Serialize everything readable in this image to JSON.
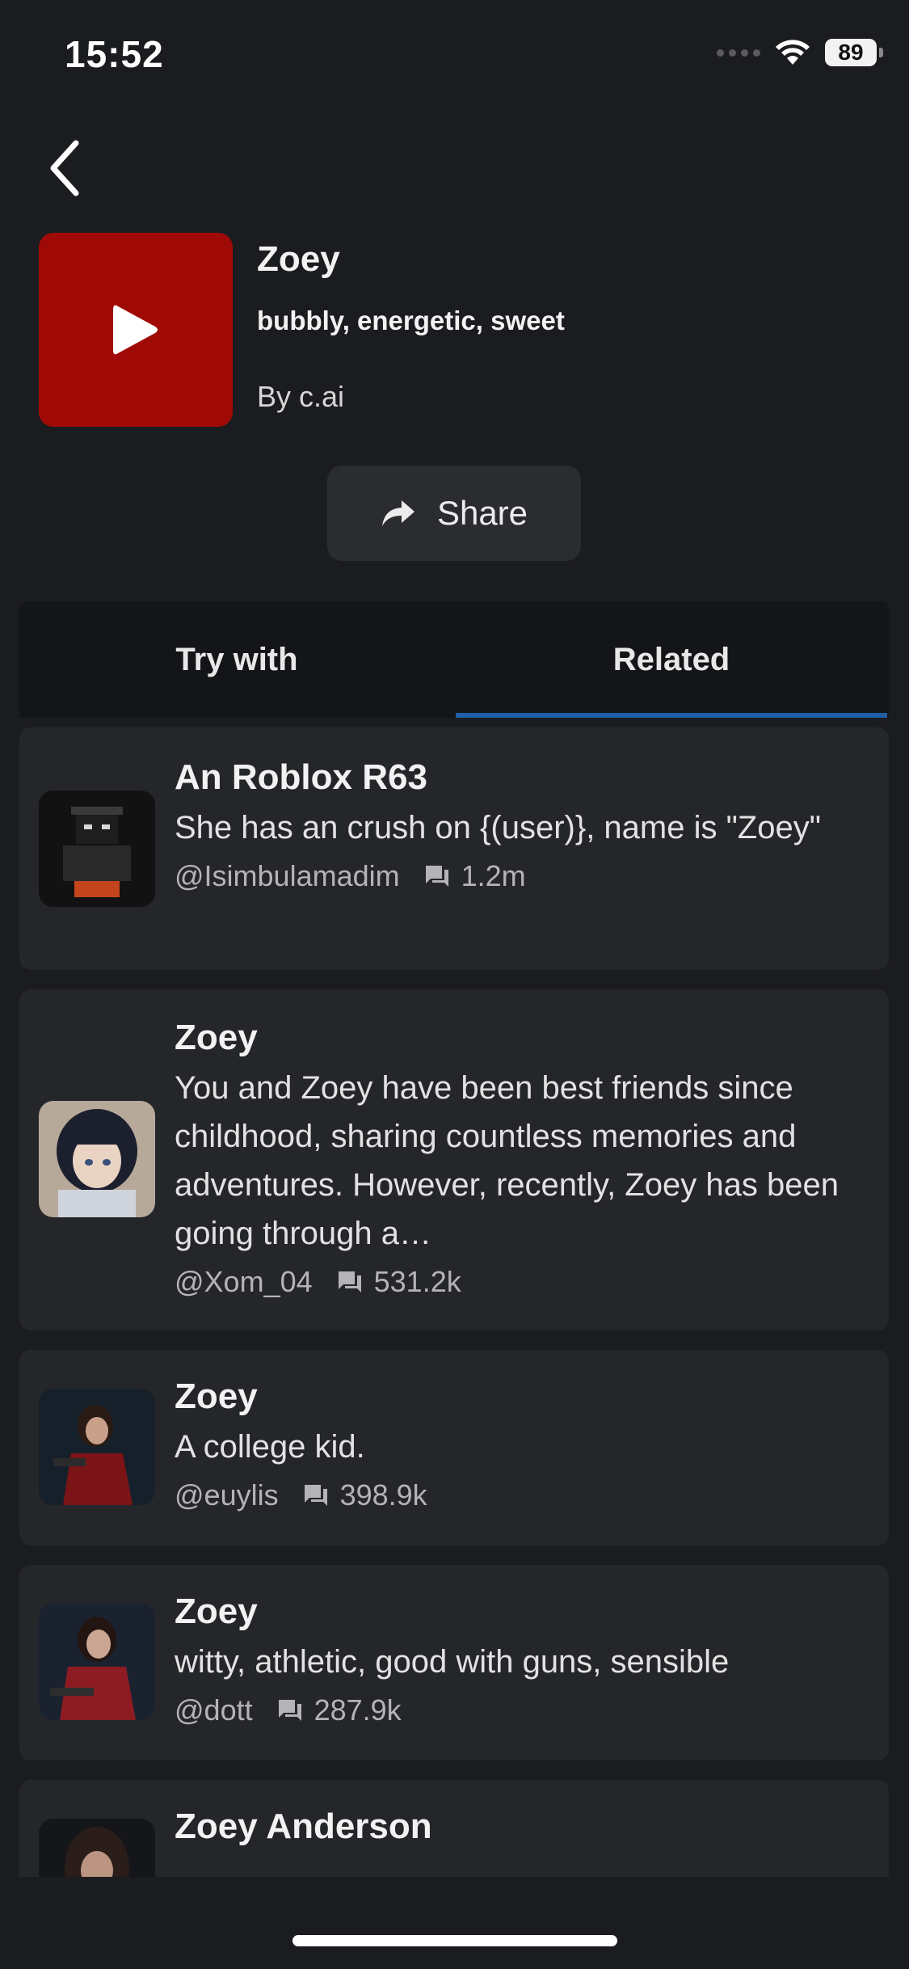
{
  "status_bar": {
    "time": "15:52",
    "battery": "89"
  },
  "character": {
    "name": "Zoey",
    "tagline": "bubbly, energetic, sweet",
    "author": "By c.ai",
    "thumb_color": "#a00a06"
  },
  "share": {
    "label": "Share"
  },
  "tabs": [
    {
      "label": "Try with",
      "active": false
    },
    {
      "label": "Related",
      "active": true
    }
  ],
  "related": [
    {
      "title": "An Roblox R63",
      "description": "She has an crush on {(user)}, name is \"Zoey\"",
      "author": "@Isimbulamadim",
      "chats": "1.2m"
    },
    {
      "title": "Zoey",
      "description": "You and Zoey have been best friends since childhood, sharing countless memories and adventures. However, recently, Zoey has been going through a…",
      "author": "@Xom_04",
      "chats": "531.2k"
    },
    {
      "title": "Zoey",
      "description": "A college kid.",
      "author": "@euylis",
      "chats": "398.9k"
    },
    {
      "title": "Zoey",
      "description": "witty, athletic, good with guns, sensible",
      "author": "@dott",
      "chats": "287.9k"
    },
    {
      "title": "Zoey Anderson",
      "description": "",
      "author": "",
      "chats": ""
    }
  ],
  "colors": {
    "background": "#1b1c1f",
    "card": "#24262a",
    "tab_bar": "#141518",
    "tab_indicator": "#1f5fa8",
    "share_button": "#2a2c30"
  },
  "icons": {
    "back": "chevron-left-icon",
    "play": "play-icon",
    "share": "share-arrow-icon",
    "chat_count": "chat-bubble-icon",
    "wifi": "wifi-icon",
    "signal": "cellular-signal-icon",
    "battery": "battery-icon"
  }
}
